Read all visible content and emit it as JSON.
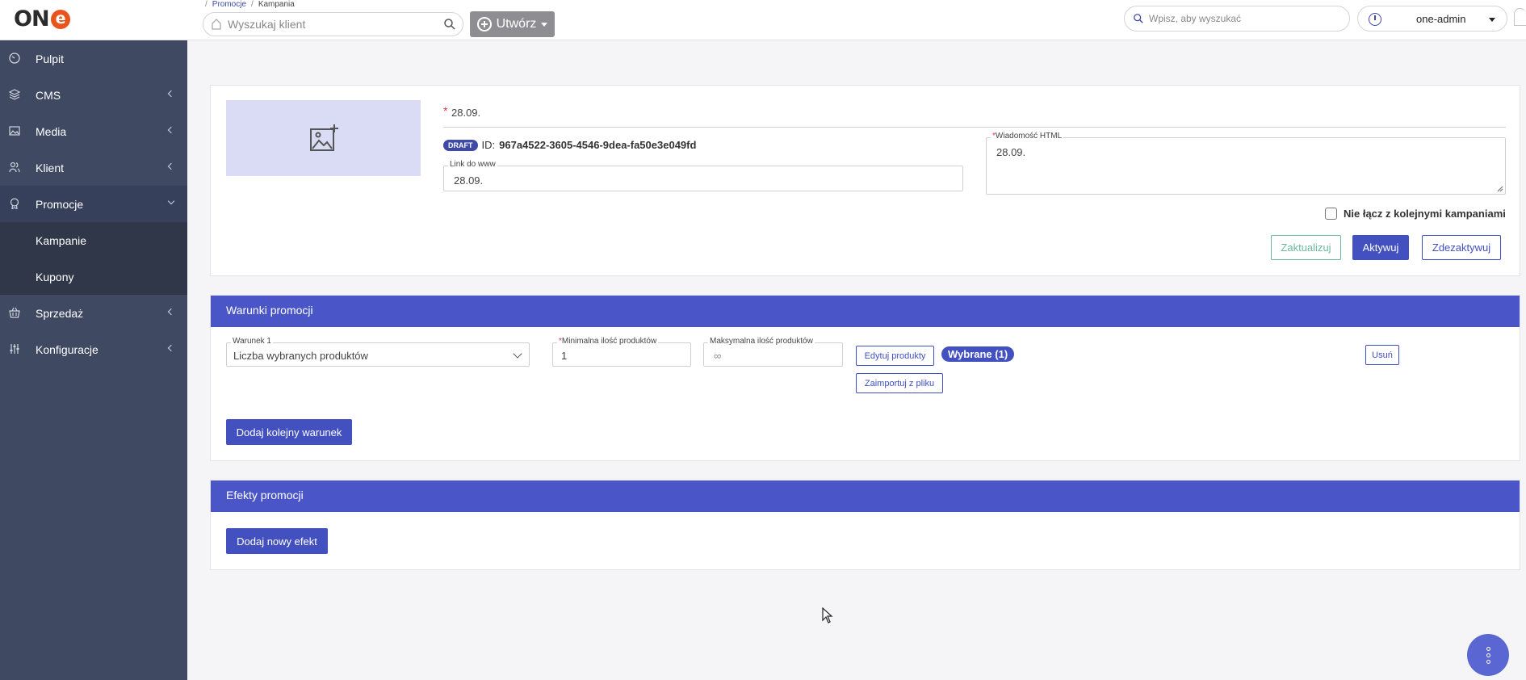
{
  "topbar": {
    "logo_text": "ON",
    "logo_e": "e",
    "breadcrumb": [
      "Promocje",
      "Kampania"
    ],
    "client_search_placeholder": "Wyszukaj klient",
    "create_label": "Utwórz",
    "global_search_placeholder": "Wpisz, aby wyszukać",
    "user": "one-admin"
  },
  "sidebar": {
    "items": [
      {
        "label": "Pulpit",
        "icon": "dashboard-icon"
      },
      {
        "label": "CMS",
        "icon": "layers-icon"
      },
      {
        "label": "Media",
        "icon": "image-icon"
      },
      {
        "label": "Klient",
        "icon": "users-icon"
      },
      {
        "label": "Promocje",
        "icon": "badge-icon"
      },
      {
        "label": "Sprzedaż",
        "icon": "basket-icon"
      },
      {
        "label": "Konfiguracje",
        "icon": "sliders-icon"
      }
    ],
    "submenu": [
      "Kampanie",
      "Kupony"
    ]
  },
  "campaign": {
    "name": "28.09.",
    "status_badge": "DRAFT",
    "id_label": "ID:",
    "id_value": "967a4522-3605-4546-9dea-fa50e3e049fd",
    "link_label": "Link do www",
    "link_value": "28.09.",
    "html_label": "Wiadomość HTML",
    "html_value": "28.09.",
    "checkbox_label": "Nie łącz z kolejnymi kampaniami",
    "btn_update": "Zaktualizuj",
    "btn_activate": "Aktywuj",
    "btn_deactivate": "Zdezaktywuj"
  },
  "conditions": {
    "title": "Warunki promocji",
    "condition_label": "Warunek 1",
    "condition_value": "Liczba wybranych produktów",
    "min_label": "Minimalna ilość produktów",
    "min_value": "1",
    "max_label": "Maksymalna ilość produktów",
    "max_value": "∞",
    "btn_edit_products": "Edytuj produkty",
    "selected_chip": "Wybrane (1)",
    "btn_import": "Zaimportuj z pliku",
    "btn_remove": "Usuń",
    "btn_add_condition": "Dodaj kolejny warunek"
  },
  "effects": {
    "title": "Efekty promocji",
    "btn_add_effect": "Dodaj nowy efekt"
  },
  "colors": {
    "sidebar": "#3f4961",
    "primary": "#4250c0",
    "section_header": "#4a56c8"
  }
}
